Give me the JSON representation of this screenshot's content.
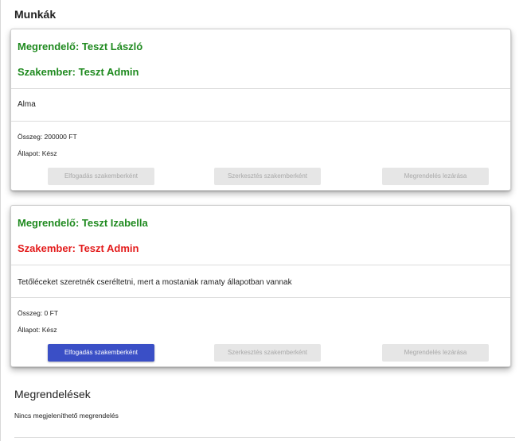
{
  "jobs_section": {
    "title": "Munkák"
  },
  "cards": [
    {
      "customer": "Megrendelő: Teszt László",
      "specialist": "Szakember: Teszt Admin",
      "description": "Alma",
      "amount": "Összeg: 200000 FT",
      "status": "Állapot: Kész",
      "buttons": {
        "accept": "Elfogadás szakemberként",
        "edit": "Szerkesztés szakemberként",
        "close": "Megrendelés lezárása"
      },
      "specialist_color": "#1f8a1f",
      "accept_enabled": false
    },
    {
      "customer": "Megrendelő: Teszt Izabella",
      "specialist": "Szakember: Teszt Admin",
      "description": "Tetőléceket szeretnék cseréltetni, mert a mostaniak ramaty állapotban vannak",
      "amount": "Összeg: 0 FT",
      "status": "Állapot: Kész",
      "buttons": {
        "accept": "Elfogadás szakemberként",
        "edit": "Szerkesztés szakemberként",
        "close": "Megrendelés lezárása"
      },
      "specialist_color": "#e31b1b",
      "accept_enabled": true
    }
  ],
  "orders_section": {
    "title": "Megrendelések",
    "empty_text": "Nincs megjeleníthető megrendelés"
  },
  "colors": {
    "customer_green": "#1f8a1f",
    "specialist_red": "#e31b1b",
    "primary_button": "#3a4fc6",
    "disabled_button": "#e6e6e6"
  }
}
